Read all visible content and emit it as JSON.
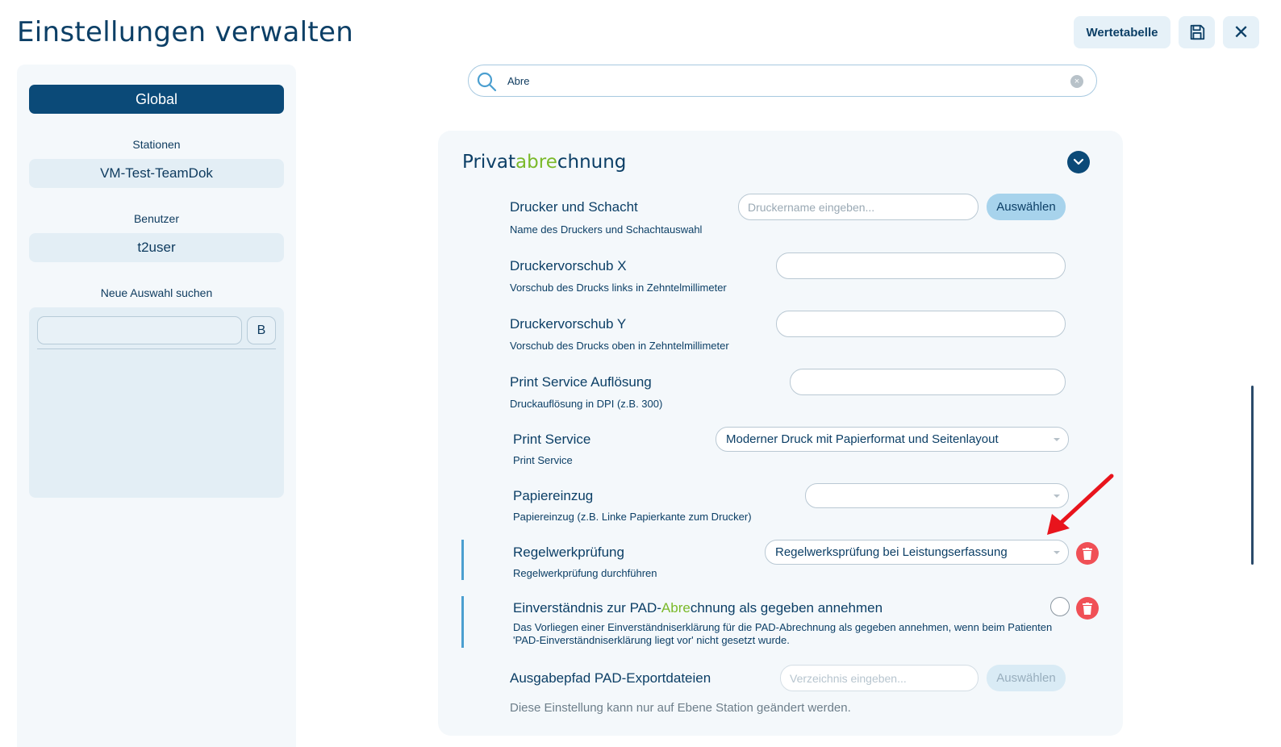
{
  "header": {
    "title": "Einstellungen verwalten",
    "value_table_label": "Wertetabelle",
    "save_icon": "save-icon",
    "close_icon": "close-icon",
    "close_glyph": "✕"
  },
  "sidebar": {
    "global_label": "Global",
    "stations_label": "Stationen",
    "station_value": "VM-Test-TeamDok",
    "user_label": "Benutzer",
    "user_value": "t2user",
    "search_label": "Neue Auswahl suchen",
    "search_value": "",
    "b_button": "B"
  },
  "search": {
    "value": "Abre",
    "clear_glyph": "×"
  },
  "section": {
    "title_pre": "Privat",
    "title_hl": "abre",
    "title_post": "chnung",
    "rows": [
      {
        "title": "Drucker und Schacht",
        "desc": "Name des Druckers und Schachtauswahl",
        "placeholder": "Druckername eingeben...",
        "button": "Auswählen"
      },
      {
        "title": "Druckervorschub X",
        "desc": "Vorschub des Drucks links in Zehntelmillimeter",
        "value": ""
      },
      {
        "title": "Druckervorschub Y",
        "desc": "Vorschub des Drucks oben in Zehntelmillimeter",
        "value": ""
      },
      {
        "title": "Print Service Auflösung",
        "desc": "Druckauflösung in DPI (z.B. 300)",
        "value": ""
      },
      {
        "title": "Print Service",
        "desc": "Print Service",
        "selected": "Moderner Druck mit Papierformat und Seitenlayout"
      },
      {
        "title": "Papiereinzug",
        "desc": "Papiereinzug (z.B. Linke Papierkante zum Drucker)",
        "selected": ""
      },
      {
        "title": "Regelwerkprüfung",
        "desc": "Regelwerkprüfung durchführen",
        "selected": "Regelwerksprüfung bei Leistungserfassung"
      },
      {
        "title_pre": "Einverständnis zur PAD-",
        "title_hl": "Abre",
        "title_post": "chnung als gegeben annehmen",
        "desc_line1": "Das Vorliegen einer Einverständniserklärung für die PAD-Abrechnung als gegeben annehmen, wenn beim Patienten",
        "desc_line2": "'PAD-Einverständniserklärung liegt vor' nicht gesetzt wurde.",
        "checked": false
      },
      {
        "title": "Ausgabepfad PAD-Exportdateien",
        "placeholder": "Verzeichnis eingeben...",
        "button": "Auswählen",
        "note": "Diese Einstellung kann nur auf Ebene Station geändert werden."
      }
    ]
  },
  "colors": {
    "primary": "#0b4a78",
    "highlight": "#7ab929",
    "delete": "#f05056",
    "annotation_arrow": "#e8141c"
  }
}
